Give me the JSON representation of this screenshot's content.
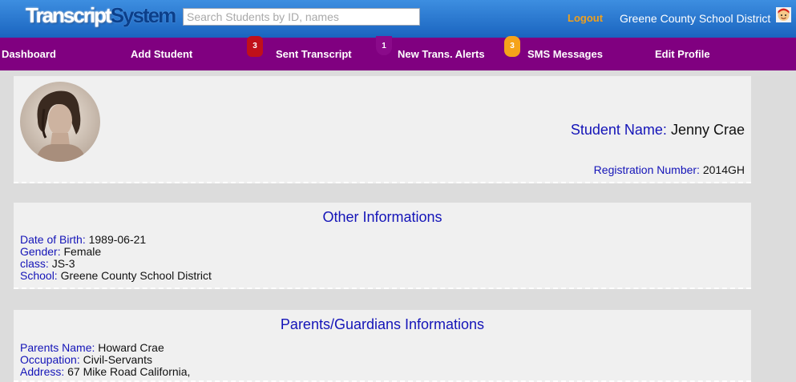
{
  "header": {
    "logo_part1": "Transcript",
    "logo_part2": "System",
    "search_placeholder": "Search Students by ID, names",
    "logout_label": "Logout",
    "district_name": "Greene County School District",
    "user_icon": "user-avatar-icon"
  },
  "nav": {
    "items": [
      {
        "label": "Dashboard"
      },
      {
        "label": "Add Student"
      },
      {
        "label": "Sent Transcript"
      },
      {
        "label": "New Trans. Alerts"
      },
      {
        "label": "SMS Messages"
      },
      {
        "label": "Edit Profile"
      }
    ],
    "badges": {
      "sent_transcript": "3",
      "new_alerts": "1",
      "sms": "3"
    }
  },
  "student": {
    "name_label": "Student Name:",
    "name": "Jenny Crae",
    "reg_label": "Registration Number:",
    "reg_number": "2014GH"
  },
  "other_info": {
    "title": "Other Informations",
    "dob_label": "Date of Birth:",
    "dob": "1989-06-21",
    "gender_label": "Gender:",
    "gender": "Female",
    "class_label": "class:",
    "class": "JS-3",
    "school_label": "School:",
    "school": "Greene County School District"
  },
  "parents": {
    "title": "Parents/Guardians Informations",
    "name_label": "Parents Name:",
    "name": "Howard Crae",
    "occupation_label": "Occupation:",
    "occupation": "Civil-Servants",
    "address_label": "Address:",
    "address": "67 Mike Road California,"
  },
  "colors": {
    "header_top": "#3d8ee0",
    "header_bottom": "#1a64bf",
    "nav_bg": "#800080",
    "label_blue": "#1414b8",
    "logout_orange": "#f0a01c"
  }
}
